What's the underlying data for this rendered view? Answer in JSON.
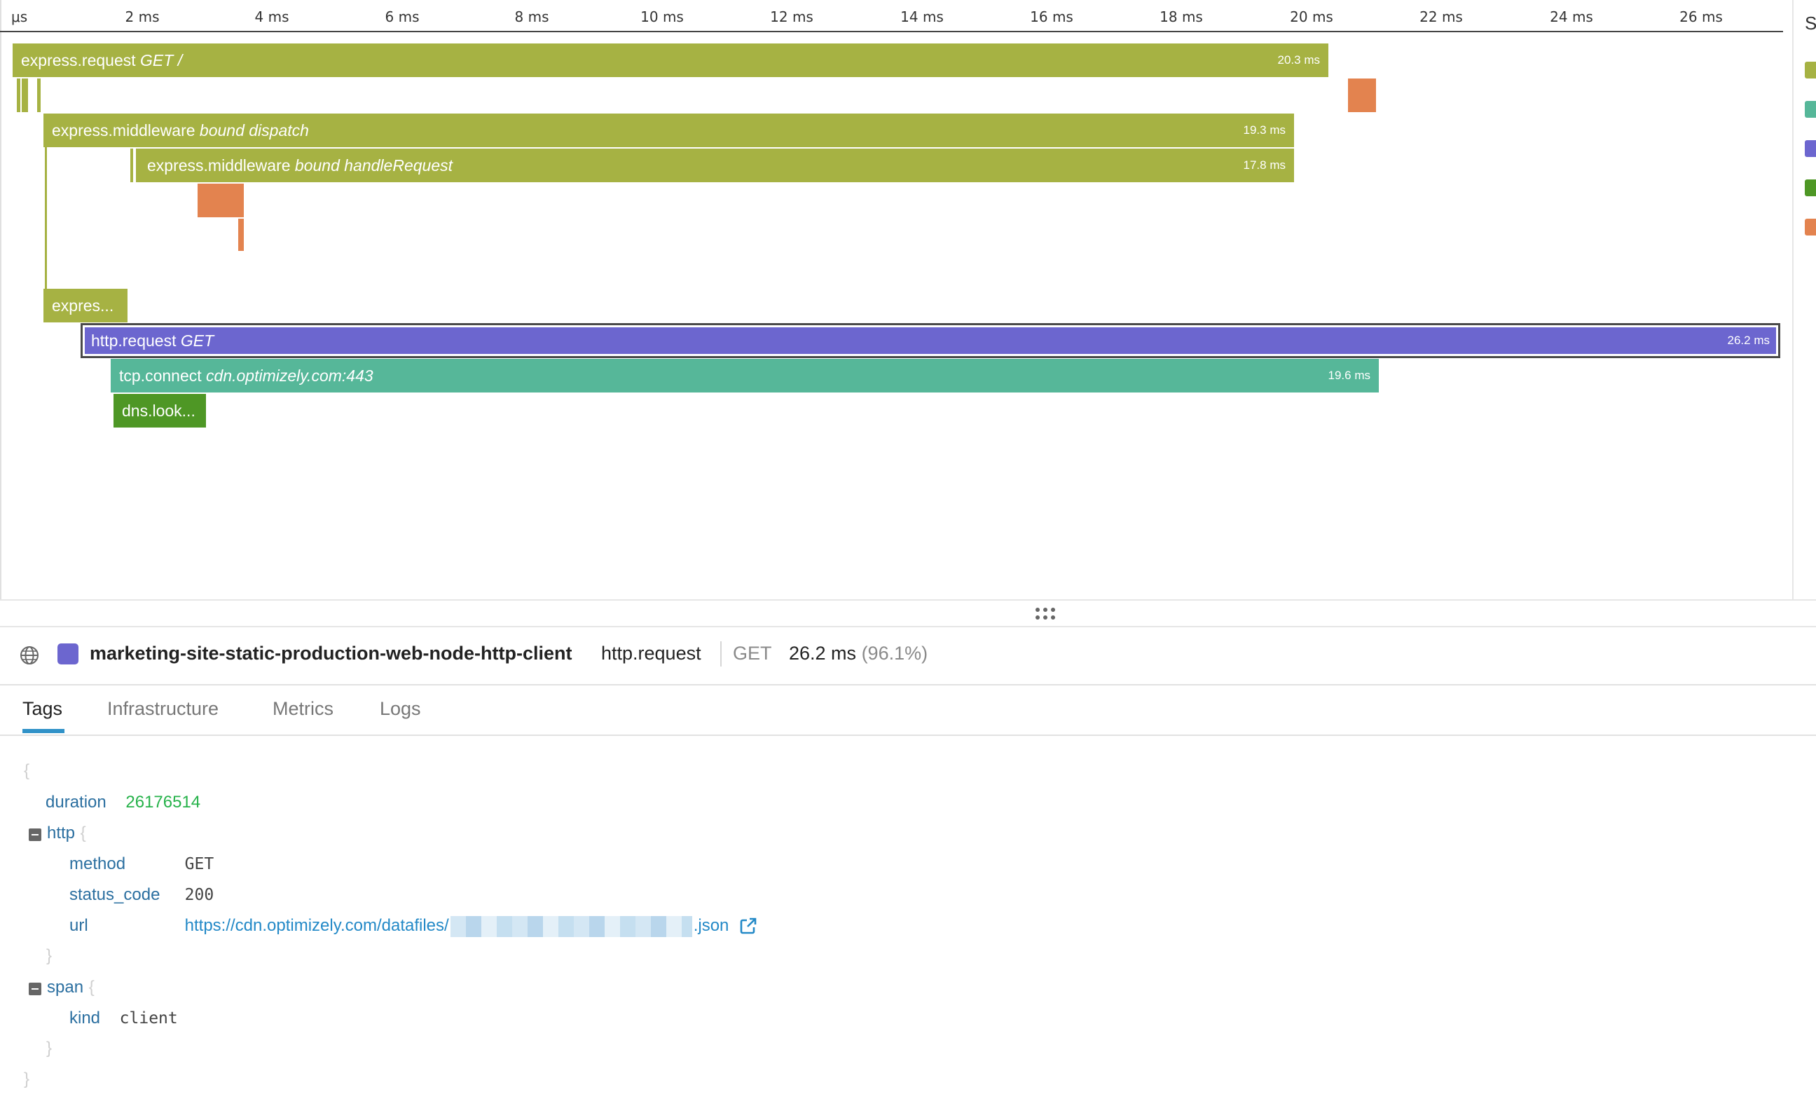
{
  "axis": {
    "ticks": [
      "μs",
      "2 ms",
      "4 ms",
      "6 ms",
      "8 ms",
      "10 ms",
      "12 ms",
      "14 ms",
      "16 ms",
      "18 ms",
      "20 ms",
      "22 ms",
      "24 ms",
      "26 ms"
    ]
  },
  "colors": {
    "express": "#a6b243",
    "http": "#6c66cf",
    "tcp": "#56b799",
    "dns": "#4e9725",
    "other": "#e3834f"
  },
  "spans": {
    "express_request": {
      "name": "express.request",
      "resource": "GET /",
      "duration": "20.3 ms"
    },
    "bound_dispatch": {
      "name": "express.middleware",
      "resource": "bound dispatch",
      "duration": "19.3 ms"
    },
    "bound_handle_request": {
      "name": "express.middleware",
      "resource": "bound handleRequest",
      "duration": "17.8 ms"
    },
    "expres_truncated": {
      "label": "expres..."
    },
    "http_request": {
      "name": "http.request",
      "resource": "GET",
      "duration": "26.2 ms"
    },
    "tcp_connect": {
      "name": "tcp.connect",
      "resource": "cdn.optimizely.com:443",
      "duration": "19.6 ms"
    },
    "dns_truncated": {
      "label": "dns.look..."
    }
  },
  "legend": {
    "title_fragment": "S"
  },
  "detail": {
    "service": "marketing-site-static-production-web-node-http-client",
    "resource": "http.request",
    "method": "GET",
    "duration": "26.2 ms",
    "percent": "(96.1%)"
  },
  "tabs": [
    "Tags",
    "Infrastructure",
    "Metrics",
    "Logs"
  ],
  "tags": {
    "open_brace": "{",
    "close_brace": "}",
    "duration_key": "duration",
    "duration_value": "26176514",
    "http_key": "http",
    "method_key": "method",
    "method_value": "GET",
    "status_code_key": "status_code",
    "status_code_value": "200",
    "url_key": "url",
    "url_prefix": "https://cdn.optimizely.com/datafiles/",
    "url_suffix": ".json",
    "span_key": "span",
    "kind_key": "kind",
    "kind_value": "client"
  }
}
